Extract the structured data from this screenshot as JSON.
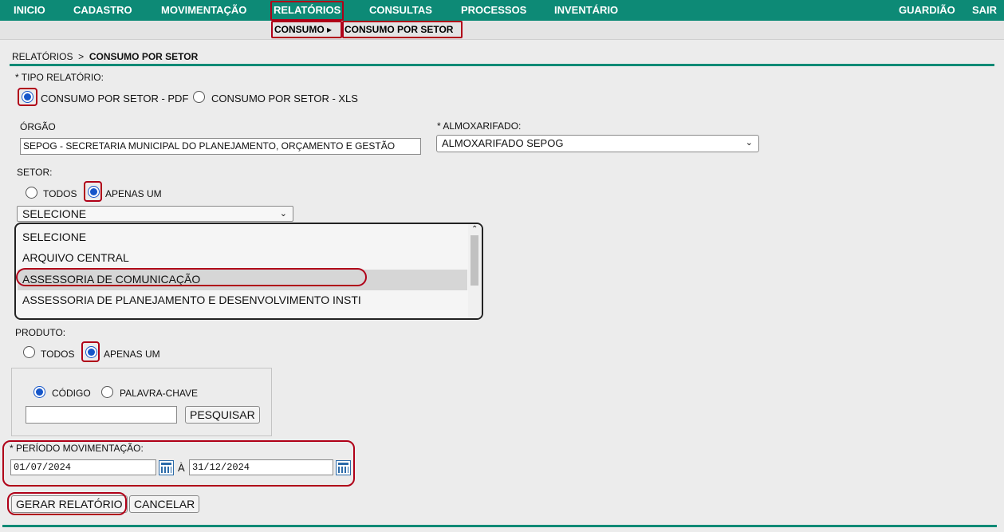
{
  "nav": {
    "items": [
      "INICIO",
      "CADASTRO",
      "MOVIMENTAÇÃO",
      "RELATÓRIOS",
      "CONSULTAS",
      "PROCESSOS",
      "INVENTÁRIO"
    ],
    "right": [
      "GUARDIÃO",
      "SAIR"
    ]
  },
  "subnav": {
    "consumo": "CONSUMO",
    "arrow": "▸",
    "consumo_setor": "CONSUMO POR SETOR"
  },
  "breadcrumb": {
    "parent": "RELATÓRIOS",
    "sep": ">",
    "current": "CONSUMO POR SETOR"
  },
  "tipo": {
    "label": "* TIPO RELATÓRIO:",
    "options": [
      "CONSUMO POR SETOR - PDF",
      "CONSUMO POR SETOR - XLS"
    ],
    "selected": 0
  },
  "orgao": {
    "label": "ÓRGÃO",
    "value": "SEPOG - SECRETARIA MUNICIPAL DO PLANEJAMENTO, ORÇAMENTO E GESTÃO"
  },
  "almoxarifado": {
    "label": "* ALMOXARIFADO:",
    "value": "ALMOXARIFADO SEPOG"
  },
  "setor": {
    "label": "SETOR:",
    "options": [
      "TODOS",
      "APENAS UM"
    ],
    "selected": 1,
    "select_value": "SELECIONE",
    "list": [
      "SELECIONE",
      "ARQUIVO CENTRAL",
      "ASSESSORIA DE COMUNICAÇÃO",
      "ASSESSORIA DE PLANEJAMENTO E DESENVOLVIMENTO INSTI"
    ],
    "highlighted": 2
  },
  "produto": {
    "label": "PRODUTO:",
    "options": [
      "TODOS",
      "APENAS UM"
    ],
    "selected": 1,
    "search_options": [
      "CÓDIGO",
      "PALAVRA-CHAVE"
    ],
    "search_selected": 0,
    "search_value": "",
    "search_button": "PESQUISAR"
  },
  "periodo": {
    "label": "* PERÍODO MOVIMENTAÇÃO:",
    "start": "01/07/2024",
    "sep": "À",
    "end": "31/12/2024"
  },
  "actions": {
    "generate": "GERAR RELATÓRIO",
    "cancel": "CANCELAR"
  },
  "colors": {
    "nav_bg": "#0d8a76",
    "highlight": "#b00018",
    "radio": "#1656c9"
  }
}
